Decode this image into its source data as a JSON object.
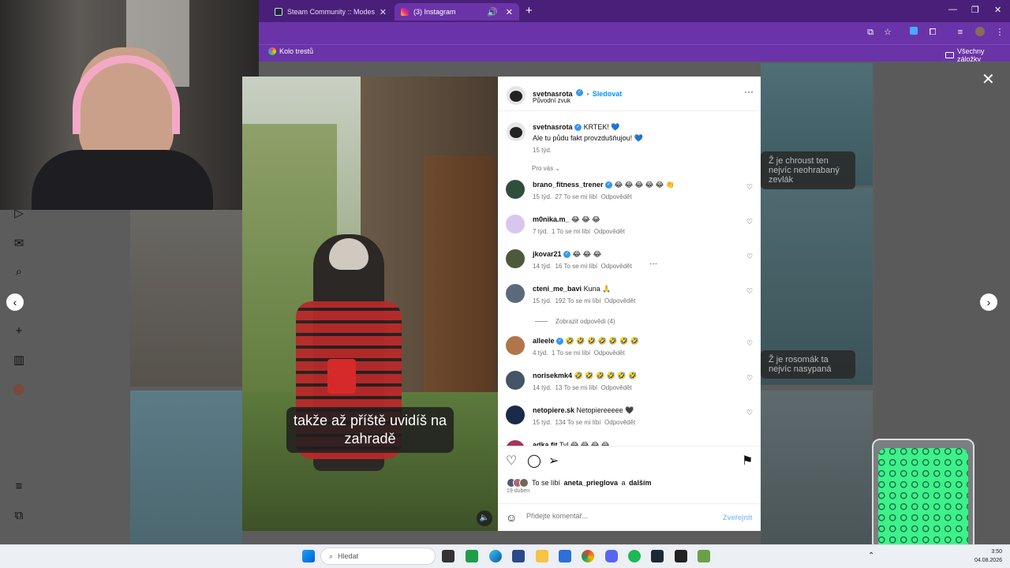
{
  "browser": {
    "tabs": [
      {
        "title": "Steam Community :: ModestoC",
        "active": false
      },
      {
        "title": "(3) Instagram",
        "active": true
      }
    ],
    "bookmarks_left": "Kolo trestů",
    "bookmarks_right": "Všechny záložky"
  },
  "post": {
    "username": "svetnasrota",
    "follow_label": "Sledovat",
    "dot": "•",
    "audio": "Původní zvuk",
    "more": "···",
    "caption": {
      "username": "svetnasrota",
      "line1": "KRTEK! 💙",
      "line2": "Ale tu půdu fakt provzdušňujou! 💙",
      "time": "15 týd."
    },
    "filter_label": "Pro vás",
    "comments": [
      {
        "user": "brano_fitness_trener",
        "verified": true,
        "text": "😂 😂 😂 😂 😂 👏",
        "time": "15 týd.",
        "likes": "27 To se mi líbí",
        "reply": "Odpovědět"
      },
      {
        "user": "m0nika.m_",
        "verified": false,
        "text": "😂 😂 😂",
        "time": "7 týd.",
        "likes": "1 To se mi líbí",
        "reply": "Odpovědět"
      },
      {
        "user": "jkovar21",
        "verified": true,
        "text": "😂 😂 😂",
        "time": "14 týd.",
        "likes": "16 To se mi líbí",
        "reply": "Odpovědět"
      },
      {
        "user": "cteni_me_bavi",
        "verified": false,
        "text": "Kuna 🙏",
        "time": "15 týd.",
        "likes": "192 To se mi líbí",
        "reply": "Odpovědět"
      },
      {
        "user": "alleele",
        "verified": true,
        "text": "🤣 🤣 🤣 🤣 🤣 🤣 🤣",
        "time": "4 týd.",
        "likes": "1 To se mi líbí",
        "reply": "Odpovědět"
      },
      {
        "user": "norisekmk4",
        "verified": false,
        "text": "🤣 🤣 🤣 🤣 🤣 🤣",
        "time": "14 týd.",
        "likes": "13 To se mi líbí",
        "reply": "Odpovědět"
      },
      {
        "user": "netopiere.sk",
        "verified": false,
        "text": "Netopiereeeee 🖤",
        "time": "15 týd.",
        "likes": "134 To se mi líbí",
        "reply": "Odpovědět"
      },
      {
        "user": "adka.fit",
        "verified": false,
        "text": "Tyl 😂 😂 😂 😂",
        "time": "",
        "likes": "",
        "reply": ""
      }
    ],
    "replies_toggle": "Zobrazit odpovědi (4)",
    "likes_prefix": "To se líbí",
    "likes_user": "aneta_prieglova",
    "likes_and": "a",
    "likes_others": "dalším",
    "date": "19 duben",
    "comment_placeholder": "Přidejte komentář...",
    "publish_label": "Zveřejnit",
    "subtitle": "takže až příště uvidíš na zahradě"
  },
  "background_captions": [
    "Ž je chroust ten nejvíc neohrabaný zevlák",
    "Ž je rosomák ta nejvíc nasypaná"
  ],
  "taskbar": {
    "search_label": "Hledat",
    "time": "3:50",
    "date": "04.08.2026"
  },
  "colors": {
    "browser_frame": "#4a1f7a",
    "browser_toolbar": "#6a34a8",
    "ig_blue": "#0095f6",
    "verified": "#3797f0"
  }
}
